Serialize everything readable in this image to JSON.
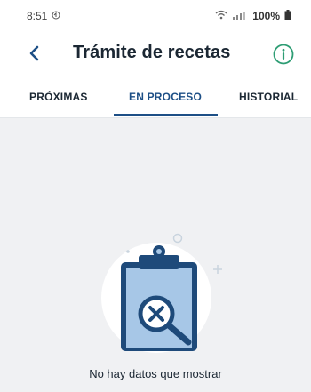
{
  "status_bar": {
    "time": "8:51",
    "battery": "100%",
    "icons": [
      "sync-icon",
      "wifi-icon",
      "signal-icon",
      "battery-icon"
    ]
  },
  "header": {
    "title": "Trámite de recetas",
    "back_icon": "chevron-left-icon",
    "info_icon": "info-circle-icon"
  },
  "tabs": [
    {
      "label": "PRÓXIMAS",
      "active": false
    },
    {
      "label": "EN PROCESO",
      "active": true
    },
    {
      "label": "HISTORIAL",
      "active": false
    }
  ],
  "empty_state": {
    "illustration": "clipboard-search-x-icon",
    "message": "No hay datos que mostrar"
  },
  "colors": {
    "primary": "#1d4f86",
    "info_accent": "#2e9d74",
    "content_bg": "#f0f1f3",
    "illustration_light": "#a7c7e7",
    "illustration_dark": "#1e4a7a"
  }
}
